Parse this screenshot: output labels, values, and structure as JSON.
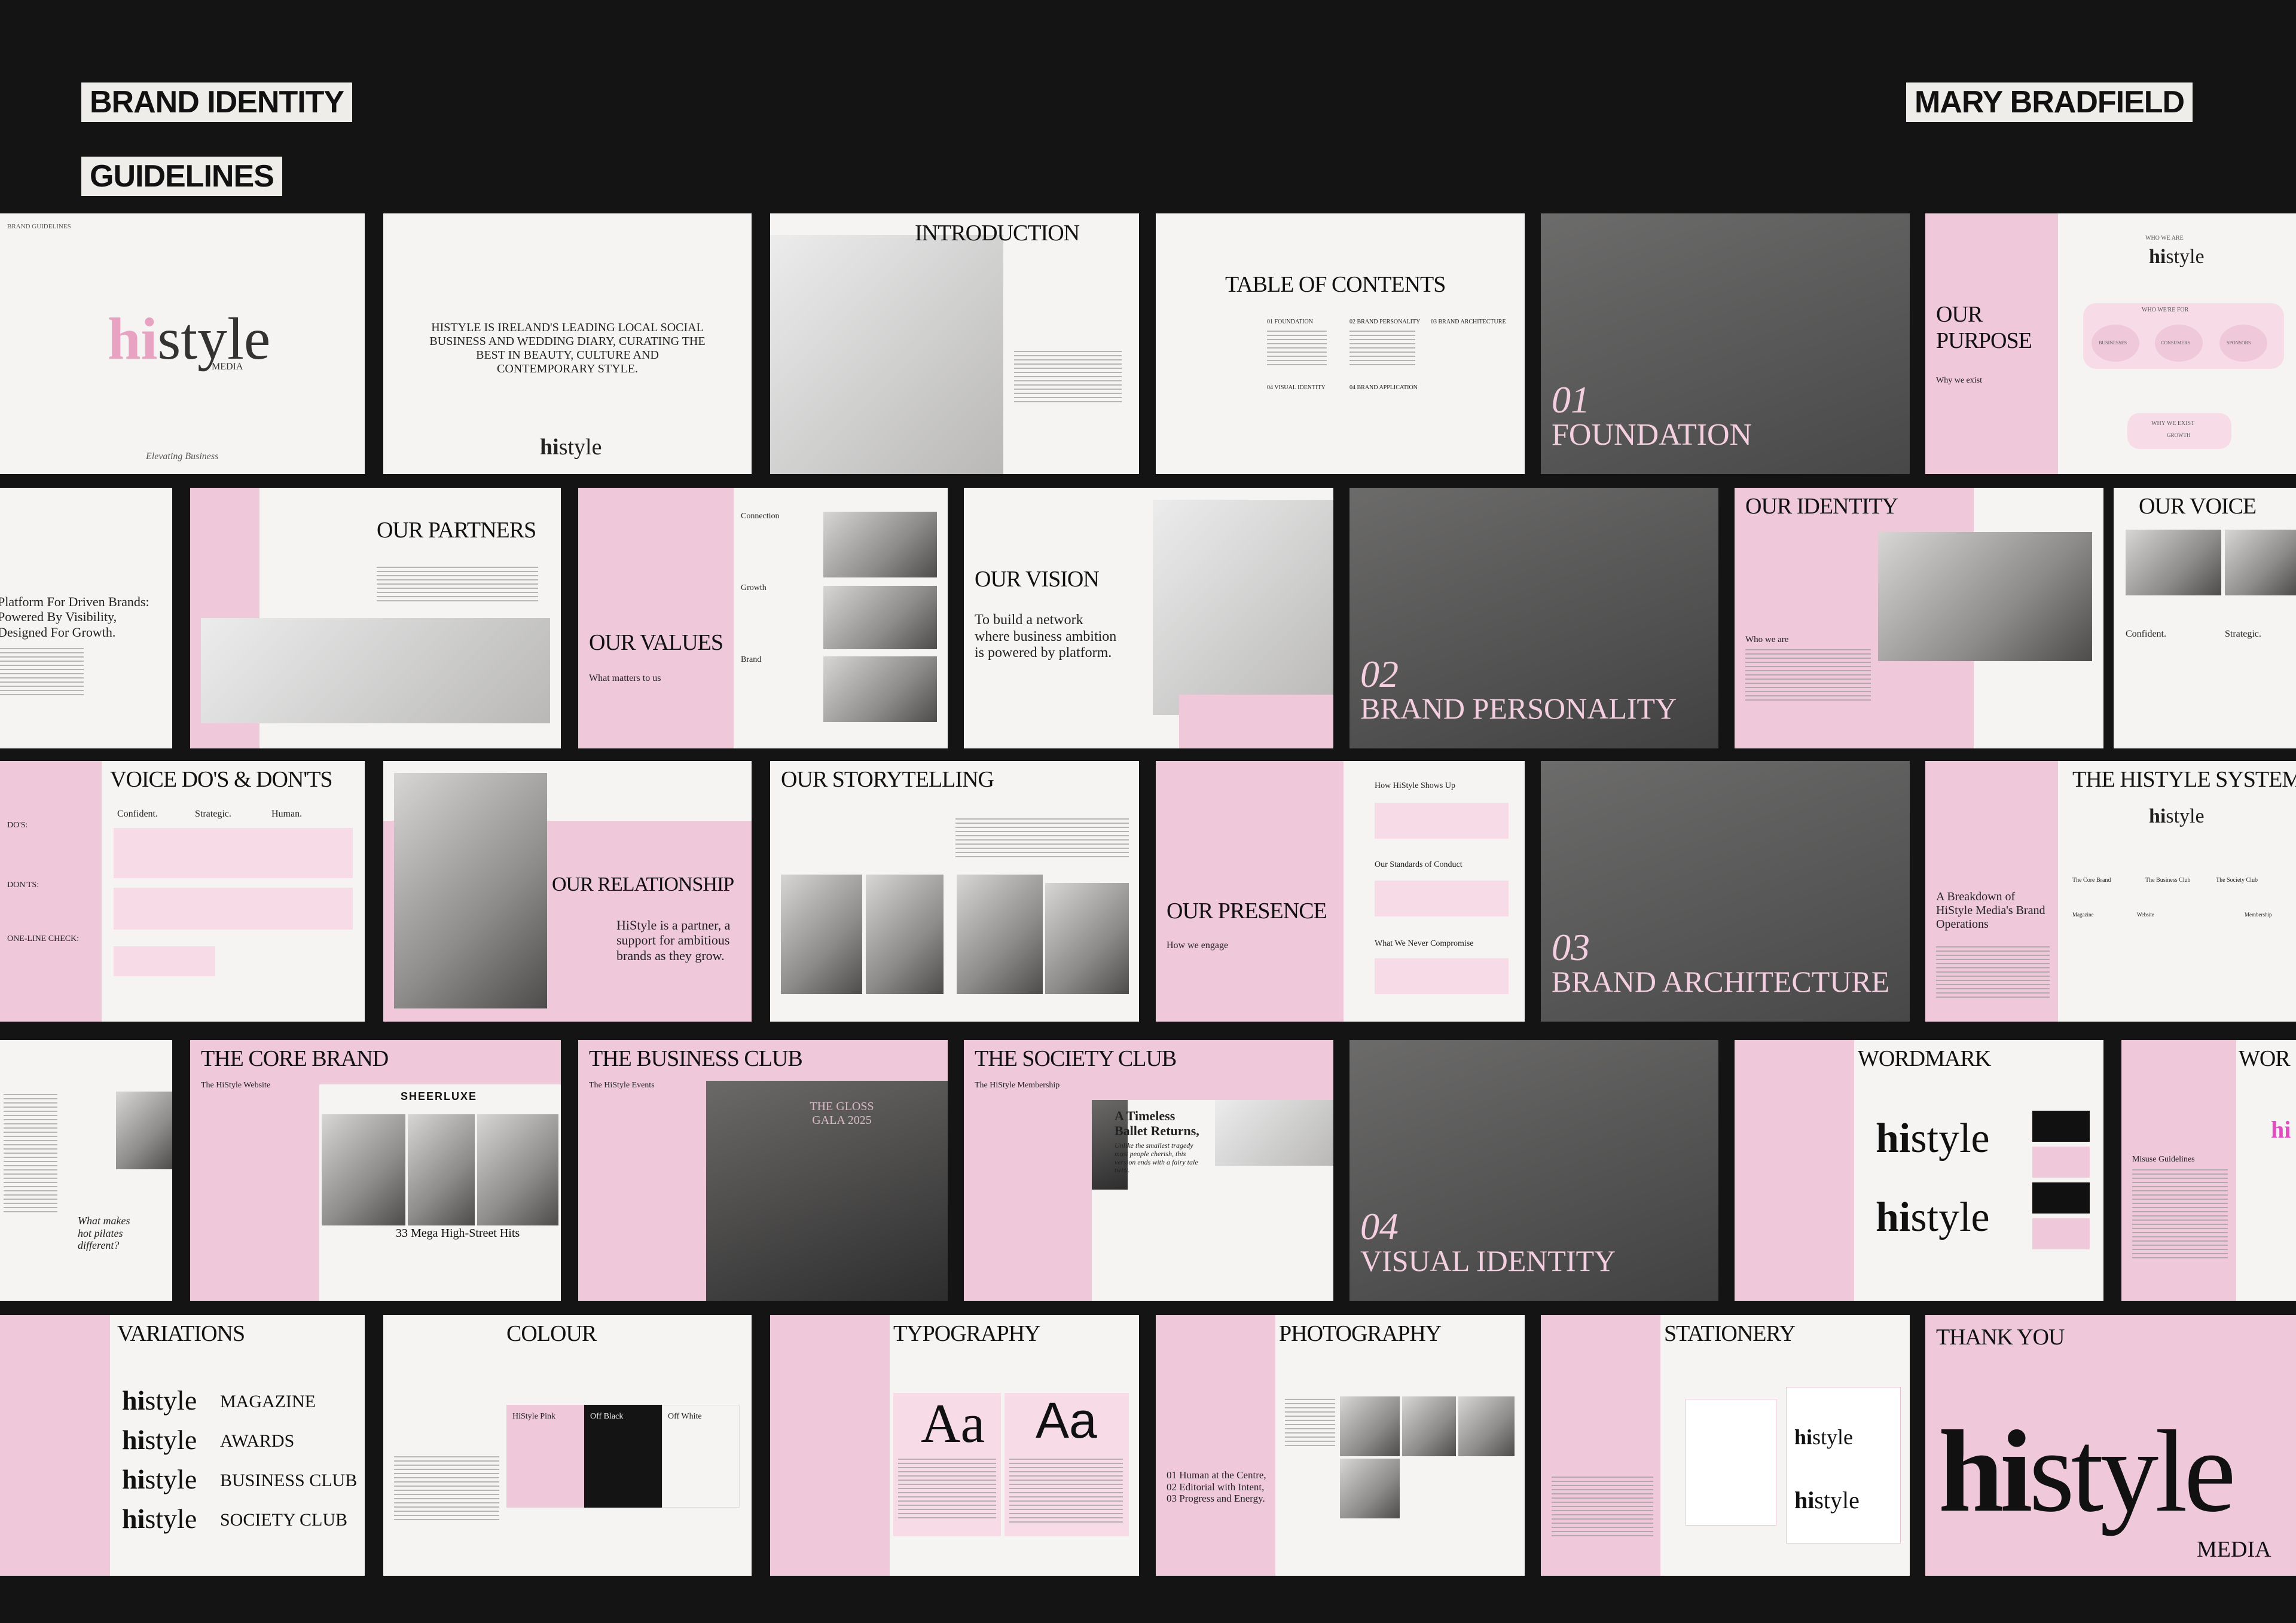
{
  "header": {
    "title_line1": "BRAND IDENTITY",
    "title_line2": "GUIDELINES",
    "author": "MARY BRADFIELD"
  },
  "brand": {
    "logo_hi": "hi",
    "logo_style": "style",
    "logo_media": "MEDIA",
    "tagline": "Elevating  Business",
    "guidelines_small": "BRAND GUIDELINES",
    "pink": "#efc9d9",
    "dark": "#141414"
  },
  "row1": {
    "intro_statement": "HISTYLE IS IRELAND'S LEADING LOCAL SOCIAL BUSINESS AND WEDDING DIARY, CURATING THE BEST IN BEAUTY, CULTURE AND CONTEMPORARY STYLE.",
    "introduction": "INTRODUCTION",
    "toc": "TABLE OF CONTENTS",
    "toc_sections": [
      "01 FOUNDATION",
      "02 BRAND PERSONALITY",
      "03 BRAND ARCHITECTURE",
      "04 VISUAL IDENTITY",
      "04 BRAND APPLICATION"
    ],
    "foundation_num": "01",
    "foundation": "FOUNDATION",
    "our_purpose_1": "OUR",
    "our_purpose_2": "PURPOSE",
    "why_we_exist": "Why we exist",
    "who_we_are": "WHO WE ARE",
    "who_we_re_for": "WHO WE'RE FOR",
    "audiences": [
      "BUSINESSES",
      "CONSUMERS",
      "SPONSORS"
    ],
    "why_we_exist_btn": "WHY WE EXIST",
    "growth": "GROWTH"
  },
  "row2": {
    "platform_text": "Platform For Driven Brands: Powered By Visibility, Designed For Growth.",
    "our_partners": "OUR PARTNERS",
    "our_values": "OUR VALUES",
    "what_matters": "What matters to us",
    "values": [
      "Connection",
      "Growth",
      "Brand"
    ],
    "our_vision": "OUR VISION",
    "vision_text": "To build a network where business ambition is powered by platform.",
    "personality_num": "02",
    "personality": "BRAND PERSONALITY",
    "our_identity": "OUR IDENTITY",
    "who_we_are_2": "Who we are",
    "our_voice": "OUR VOICE",
    "voice_words": [
      "Confident.",
      "Strategic."
    ]
  },
  "row3": {
    "voice_dos": "VOICE DO'S & DON'TS",
    "voice_cols": [
      "Confident.",
      "Strategic.",
      "Human."
    ],
    "dos": "DO'S:",
    "donts": "DON'TS:",
    "one_line": "ONE-LINE CHECK:",
    "our_relationship": "OUR RELATIONSHIP",
    "relationship_text": "HiStyle is a partner, a support for ambitious brands as they grow.",
    "our_storytelling": "OUR STORYTELLING",
    "our_presence": "OUR PRESENCE",
    "how_we_engage": "How we engage",
    "presence_heads": [
      "How HiStyle Shows Up",
      "Our Standards of Conduct",
      "What We Never Compromise"
    ],
    "architecture_num": "03",
    "architecture": "BRAND ARCHITECTURE",
    "histyle_system": "THE HISTYLE SYSTEM",
    "breakdown": "A Breakdown of HiStyle Media's Brand Operations",
    "system_nodes": [
      "The Core Brand",
      "The Business Club",
      "The Society Club",
      "Magazine",
      "Website",
      "Membership"
    ]
  },
  "row4": {
    "what_makes": "What makes hot pilates different?",
    "core_brand": "THE CORE BRAND",
    "histyle_website": "The HiStyle Website",
    "sheerluxe": "SHEERLUXE",
    "mega_hits": "33 Mega High-Street Hits",
    "business_club": "THE BUSINESS CLUB",
    "histyle_events": "The HiStyle Events",
    "gloss_gala": "THE GLOSS GALA 2025",
    "society_club": "THE SOCIETY CLUB",
    "histyle_membership": "The HiStyle Membership",
    "ballet": "A Timeless Ballet Returns,",
    "ballet_sub": "Unlike the smallest tragedy most people cherish, this version ends with a fairy tale twist.",
    "visual_num": "04",
    "visual": "VISUAL IDENTITY",
    "wordmark": "WORDMARK",
    "wordmark_cut": "WOR",
    "misuse": "Misuse Guidelines"
  },
  "row5": {
    "variations": "VARIATIONS",
    "variation_labels": [
      "MAGAZINE",
      "AWARDS",
      "BUSINESS CLUB",
      "SOCIETY CLUB"
    ],
    "colour": "COLOUR",
    "colours": [
      {
        "name": "HiStyle Pink",
        "hex": "#efc9d9"
      },
      {
        "name": "Off Black",
        "hex": "#141414"
      },
      {
        "name": "Off White",
        "hex": "#f5f4f2"
      }
    ],
    "typography": "TYPOGRAPHY",
    "aa": "Aa",
    "weights_left": [
      "Thin",
      "Light",
      "Regular",
      "SemiBold",
      "Bold"
    ],
    "weights_right": [
      "Thin",
      "Extra Light",
      "Light",
      "Regular",
      "Medium",
      "SemiBold",
      "Bold",
      "Extra Bold",
      "Black"
    ],
    "photography": "PHOTOGRAPHY",
    "photo_principles": "01 Human at the Centre, 02 Editorial with Intent, 03 Progress and Energy.",
    "stationery": "STATIONERY",
    "thank_you": "THANK YOU"
  }
}
